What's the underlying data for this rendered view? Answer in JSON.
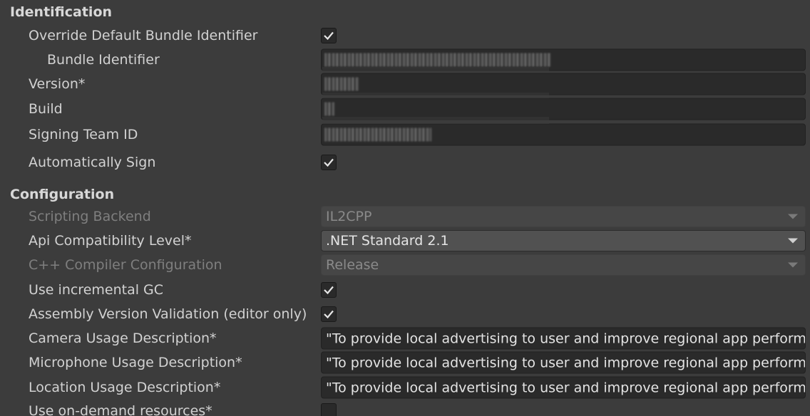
{
  "sections": {
    "identification": "Identification",
    "configuration": "Configuration"
  },
  "identification": {
    "override_bundle_label": "Override Default Bundle Identifier",
    "override_bundle_checked": true,
    "bundle_identifier_label": "Bundle Identifier",
    "version_label": "Version*",
    "build_label": "Build",
    "signing_team_label": "Signing Team ID",
    "auto_sign_label": "Automatically Sign",
    "auto_sign_checked": true
  },
  "configuration": {
    "scripting_backend_label": "Scripting Backend",
    "scripting_backend_value": "IL2CPP",
    "api_level_label": "Api Compatibility Level*",
    "api_level_value": ".NET Standard 2.1",
    "cpp_config_label": "C++ Compiler Configuration",
    "cpp_config_value": "Release",
    "incremental_gc_label": "Use incremental GC",
    "incremental_gc_checked": true,
    "assembly_validation_label": "Assembly Version Validation (editor only)",
    "assembly_validation_checked": true,
    "camera_usage_label": "Camera Usage Description*",
    "camera_usage_value": "\"To provide local advertising to user and improve regional app performa",
    "microphone_usage_label": "Microphone Usage Description*",
    "microphone_usage_value": "\"To provide local advertising to user and improve regional app performa",
    "location_usage_label": "Location Usage Description*",
    "location_usage_value": "\"To provide local advertising to user and improve regional app performa",
    "on_demand_label": "Use on-demand resources*",
    "on_demand_checked": false
  },
  "icons": {
    "check": "checkmark-icon",
    "dropdown": "triangle-down-icon"
  },
  "colors": {
    "background": "#3c3c3c",
    "field_bg": "#2a2a2a",
    "dropdown_bg": "#515151",
    "text": "#d2d2d2",
    "disabled_text": "#7f7f7f"
  }
}
